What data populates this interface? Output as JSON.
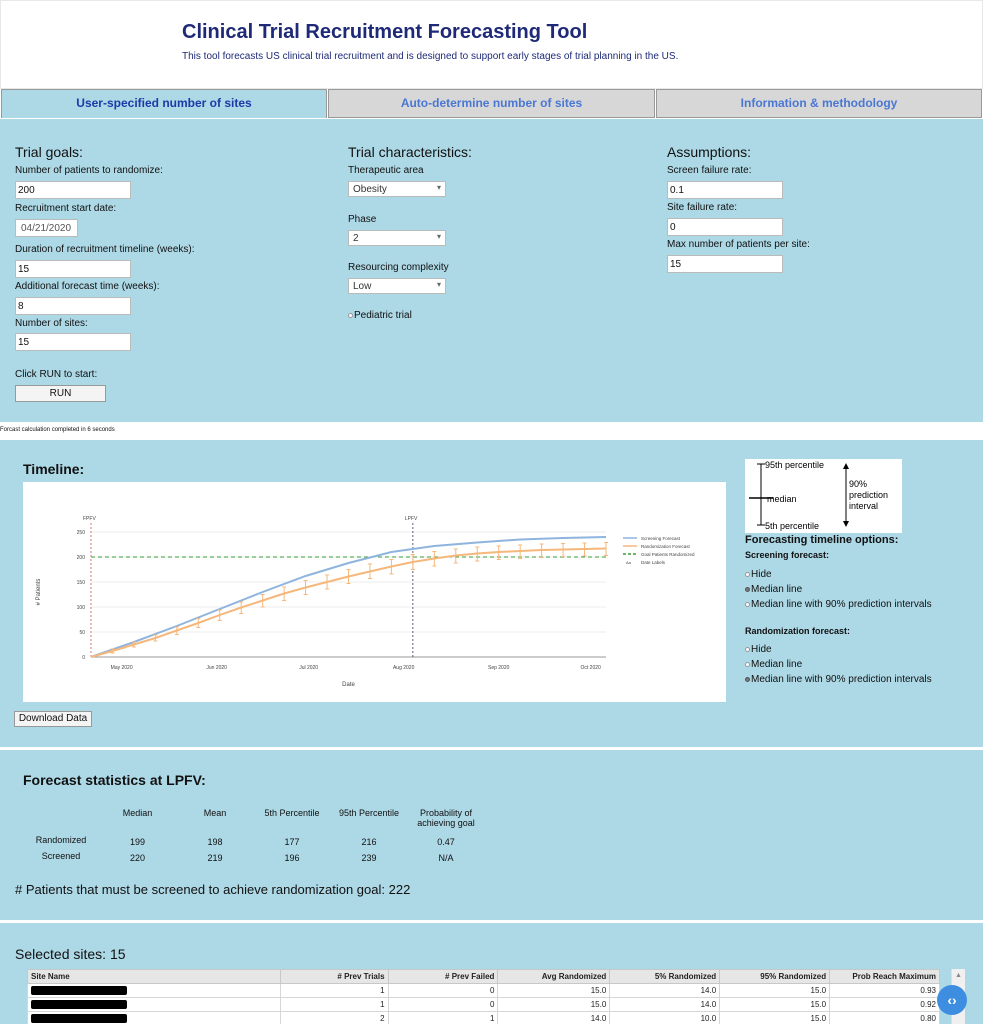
{
  "header": {
    "title": "Clinical Trial Recruitment Forecasting Tool",
    "subtitle": "This tool forecasts US clinical trial recruitment and is designed to support early stages of trial planning in the US."
  },
  "tabs": [
    {
      "label": "User-specified number of sites",
      "active": true
    },
    {
      "label": "Auto-determine number of sites",
      "active": false
    },
    {
      "label": "Information & methodology",
      "active": false
    }
  ],
  "goals": {
    "title": "Trial goals:",
    "patients_label": "Number of patients to randomize:",
    "patients_value": "200",
    "start_label": "Recruitment start date:",
    "start_value": "04/21/2020",
    "duration_label": "Duration of recruitment timeline (weeks):",
    "duration_value": "15",
    "additional_label": "Additional forecast time (weeks):",
    "additional_value": "8",
    "sites_label": "Number of sites:",
    "sites_value": "15",
    "run_hint": "Click RUN to start:",
    "run_label": "RUN"
  },
  "characteristics": {
    "title": "Trial characteristics:",
    "area_label": "Therapeutic area",
    "area_value": "Obesity",
    "phase_label": "Phase",
    "phase_value": "2",
    "complexity_label": "Resourcing complexity",
    "complexity_value": "Low",
    "pediatric_label": "Pediatric trial"
  },
  "assumptions": {
    "title": "Assumptions:",
    "screen_fail_label": "Screen failure rate:",
    "screen_fail_value": "0.1",
    "site_fail_label": "Site failure rate:",
    "site_fail_value": "0",
    "max_label": "Max number of patients per site:",
    "max_value": "15"
  },
  "status": "Forcast calculation completed in 6 seconds",
  "timeline": {
    "title": "Timeline:",
    "download_label": "Download Data",
    "legend_key": {
      "p95": "95th percentile",
      "median": "median",
      "p5": "5th percentile",
      "interval": "90% prediction interval"
    },
    "options_title": "Forecasting timeline options:",
    "screening_title": "Screening forecast:",
    "screening_options": [
      "Hide",
      "Median line",
      "Median line with 90% prediction intervals"
    ],
    "screening_selected": 1,
    "randomization_title": "Randomization forecast:",
    "randomization_options": [
      "Hide",
      "Median line",
      "Median line with 90% prediction intervals"
    ],
    "randomization_selected": 2
  },
  "chart_data": {
    "type": "line",
    "xlabel": "Date",
    "ylabel": "# Patients",
    "ylim": [
      0,
      260
    ],
    "xlim": [
      "2020-04-21",
      "2020-10-06"
    ],
    "x_ticks": [
      "May 2020",
      "Jun 2020",
      "Jul 2020",
      "Aug 2020",
      "Sep 2020",
      "Oct 2020"
    ],
    "y_ticks": [
      0,
      50,
      100,
      150,
      200,
      250
    ],
    "vlines": [
      {
        "label": "FPFV",
        "x": "2020-04-21"
      },
      {
        "label": "LPFV",
        "x": "2020-08-04"
      }
    ],
    "goal": 200,
    "legend": [
      "Screening Forecast",
      "Randomization Forecast",
      "Goal Patients Randomized",
      "Date Labels"
    ],
    "colors": {
      "screening": "#8fb4de",
      "randomization": "#f6b77a",
      "goal": "#3a9e3a",
      "fpfv": "#d9534f",
      "lpfv": "#333366"
    },
    "series": [
      {
        "name": "Screening Forecast",
        "x": [
          "2020-04-21",
          "2020-05-05",
          "2020-05-19",
          "2020-06-02",
          "2020-06-16",
          "2020-06-30",
          "2020-07-14",
          "2020-07-28",
          "2020-08-11",
          "2020-08-25",
          "2020-09-08",
          "2020-09-22",
          "2020-10-06"
        ],
        "y": [
          0,
          30,
          62,
          96,
          130,
          162,
          188,
          210,
          222,
          229,
          235,
          238,
          240
        ]
      },
      {
        "name": "Randomization Forecast",
        "x": [
          "2020-04-21",
          "2020-04-28",
          "2020-05-05",
          "2020-05-12",
          "2020-05-19",
          "2020-05-26",
          "2020-06-02",
          "2020-06-09",
          "2020-06-16",
          "2020-06-23",
          "2020-06-30",
          "2020-07-07",
          "2020-07-14",
          "2020-07-21",
          "2020-07-28",
          "2020-08-04",
          "2020-08-11",
          "2020-08-18",
          "2020-08-25",
          "2020-09-01",
          "2020-09-08",
          "2020-09-15",
          "2020-09-22",
          "2020-09-29",
          "2020-10-06"
        ],
        "y": [
          0,
          12,
          25,
          38,
          53,
          68,
          84,
          99,
          113,
          127,
          139,
          150,
          161,
          171,
          181,
          190,
          197,
          203,
          207,
          210,
          212,
          214,
          215,
          216,
          217
        ],
        "lower": [
          0,
          8,
          20,
          32,
          45,
          59,
          73,
          87,
          100,
          113,
          125,
          136,
          147,
          157,
          166,
          175,
          182,
          188,
          192,
          195,
          197,
          199,
          201,
          202,
          203
        ],
        "upper": [
          0,
          16,
          30,
          44,
          60,
          77,
          94,
          110,
          125,
          140,
          153,
          164,
          175,
          186,
          195,
          205,
          211,
          216,
          220,
          222,
          224,
          226,
          227,
          228,
          229
        ]
      }
    ]
  },
  "stats": {
    "title": "Forecast statistics at LPFV:",
    "columns": [
      "Median",
      "Mean",
      "5th Percentile",
      "95th Percentile",
      "Probability of achieving goal"
    ],
    "rows": [
      {
        "label": "Randomized",
        "values": [
          "199",
          "198",
          "177",
          "216",
          "0.47"
        ]
      },
      {
        "label": "Screened",
        "values": [
          "220",
          "219",
          "196",
          "239",
          "N/A"
        ]
      }
    ],
    "screen_needed": "# Patients that must be screened to achieve randomization goal: 222"
  },
  "sites": {
    "title": "Selected sites: 15",
    "columns": [
      "Site Name",
      "# Prev Trials",
      "# Prev Failed",
      "Avg Randomized",
      "5% Randomized",
      "95% Randomized",
      "Prob Reach Maximum"
    ],
    "rows": [
      [
        "1",
        "0",
        "15.0",
        "14.0",
        "15.0",
        "0.93"
      ],
      [
        "1",
        "0",
        "15.0",
        "14.0",
        "15.0",
        "0.92"
      ],
      [
        "2",
        "1",
        "14.0",
        "10.0",
        "15.0",
        "0.80"
      ]
    ]
  }
}
